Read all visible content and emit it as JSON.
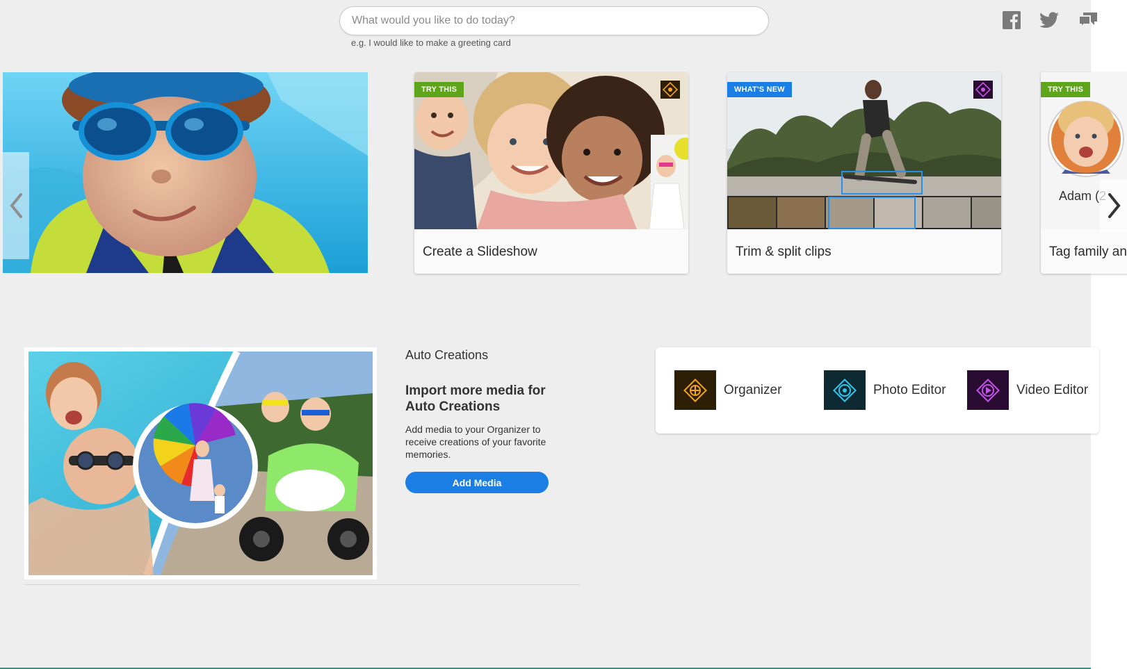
{
  "search": {
    "placeholder": "What would you like to do today?",
    "hint": "e.g. I would like to make a greeting card"
  },
  "social": [
    {
      "icon": "facebook-icon"
    },
    {
      "icon": "twitter-icon"
    },
    {
      "icon": "feedback-icon"
    }
  ],
  "carousel": {
    "tiles": [
      {
        "badge": "TRY THIS",
        "badge_color": "#5ea51b",
        "caption": "Create a Slideshow"
      },
      {
        "badge": "WHAT'S NEW",
        "badge_color": "#1a7ee5",
        "caption": "Trim & split clips"
      },
      {
        "badge": "TRY THIS",
        "badge_color": "#5ea51b",
        "caption": "Tag family an",
        "person_label": "Adam (2"
      }
    ]
  },
  "auto_creations": {
    "heading": "Auto Creations",
    "title": "Import more media for Auto Creations",
    "description": "Add media to your Organizer to receive creations of your favorite memories.",
    "button": "Add Media"
  },
  "launch": [
    {
      "label": "Organizer",
      "color": "#2d1e06",
      "accent": "#f5a31a"
    },
    {
      "label": "Photo Editor",
      "color": "#0d2a33",
      "accent": "#31c5f0"
    },
    {
      "label": "Video Editor",
      "color": "#2a0c33",
      "accent": "#c255e8"
    }
  ],
  "colors": {
    "accent_blue": "#1a7ee5",
    "badge_green": "#5ea51b"
  }
}
